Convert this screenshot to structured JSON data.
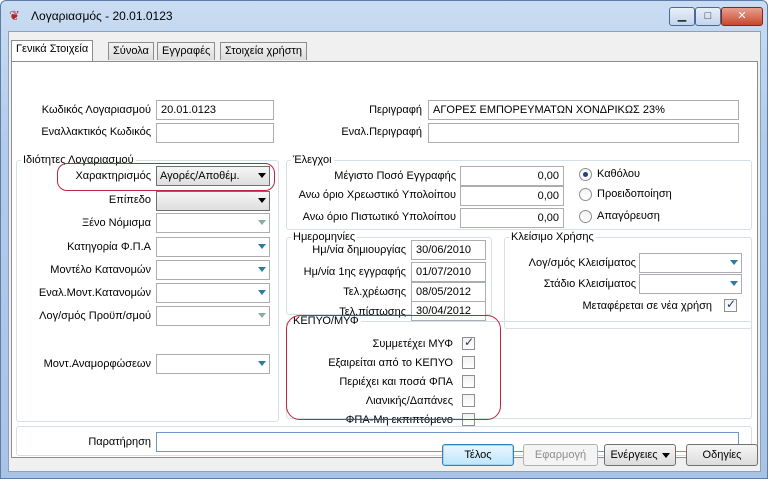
{
  "window": {
    "title": "Λογαριασμός - 20.01.0123",
    "minimize_glyph": "▁",
    "maximize_glyph": "□",
    "close_glyph": "✕",
    "icon_glyph": "❦"
  },
  "tabs": [
    {
      "label": "Γενικά Στοιχεία",
      "active": true
    },
    {
      "label": "Σύνολα",
      "active": false
    },
    {
      "label": "Εγγραφές",
      "active": false
    },
    {
      "label": "Στοιχεία χρήστη",
      "active": false
    }
  ],
  "header": {
    "code_label": "Κωδικός Λογαριασμού",
    "code_value": "20.01.0123",
    "alt_code_label": "Εναλλακτικός Κωδικός",
    "alt_code_value": "",
    "description_label": "Περιγραφή",
    "description_value": "ΑΓΟΡΕΣ ΕΜΠΟΡΕΥΜΑΤΩΝ ΧΟΝΔΡΙΚΩΣ 23%",
    "alt_description_label": "Εναλ.Περιγραφή",
    "alt_description_value": ""
  },
  "properties": {
    "title": "Ιδιότητες Λογαριασμού",
    "characterization_label": "Χαρακτηρισμός",
    "characterization_value": "Αγορές/Αποθέμ.",
    "level_label": "Επίπεδο",
    "level_value": "",
    "foreign_currency_label": "Ξένο Νόμισμα",
    "vat_category_label": "Κατηγορία Φ.Π.Α",
    "allocation_model_label": "Μοντέλο Κατανομών",
    "alt_allocation_model_label": "Εναλ.Μοντ.Κατανομών",
    "budget_account_label": "Λογ/σμός Προϋπ/σμού",
    "restatement_model_label": "Μοντ.Αναμορφώσεων"
  },
  "controls": {
    "title": "Έλεγχοι",
    "max_entry_label": "Μέγιστο Ποσό Εγγραφής",
    "max_entry_value": "0,00",
    "upper_debit_label": "Ανω όριο Χρεωστικό Υπολοίπου",
    "upper_debit_value": "0,00",
    "upper_credit_label": "Ανω όριο Πιστωτικό Υπολοίπου",
    "upper_credit_value": "0,00",
    "radio_none": "Καθόλου",
    "radio_warning": "Προειδοποίηση",
    "radio_block": "Απαγόρευση",
    "selected": "none"
  },
  "dates": {
    "title": "Ημερομηνίες",
    "created_label": "Ημ/νία δημιουργίας",
    "created_value": "30/06/2010",
    "first_entry_label": "Ημ/νία 1ης εγγραφής",
    "first_entry_value": "01/07/2010",
    "last_debit_label": "Τελ.χρέωσης",
    "last_debit_value": "08/05/2012",
    "last_credit_label": "Τελ.πίστωσης",
    "last_credit_value": "30/04/2012"
  },
  "closing": {
    "title": "Κλείσιμο Χρήσης",
    "closing_account_label": "Λογ/σμός Κλεισίματος",
    "closing_stage_label": "Στάδιο Κλεισίματος",
    "carry_forward_label": "Μεταφέρεται σε νέα χρήση",
    "carry_forward_checked": true
  },
  "kepyo": {
    "title": "ΚΕΠΥΟ/ΜΥΦ",
    "items": [
      {
        "label": "Συμμετέχει ΜΥΦ",
        "checked": true
      },
      {
        "label": "Εξαιρείται από το ΚΕΠΥΟ",
        "checked": false
      },
      {
        "label": "Περιέχει και ποσά ΦΠΑ",
        "checked": false
      },
      {
        "label": "Λιανικής/Δαπάνες",
        "checked": false
      },
      {
        "label": "ΦΠΑ-Μη εκπιπτόμενο",
        "checked": false
      }
    ]
  },
  "remarks": {
    "label": "Παρατήρηση",
    "value": ""
  },
  "footer": {
    "ok_label": "Τέλος",
    "apply_label": "Εφαρμογή",
    "actions_label": "Ενέργειες",
    "options_label": "Οδηγίες"
  },
  "colors": {
    "annotation_red": "#c0243f",
    "combo_arrow_blue": "#2a7ca0"
  }
}
